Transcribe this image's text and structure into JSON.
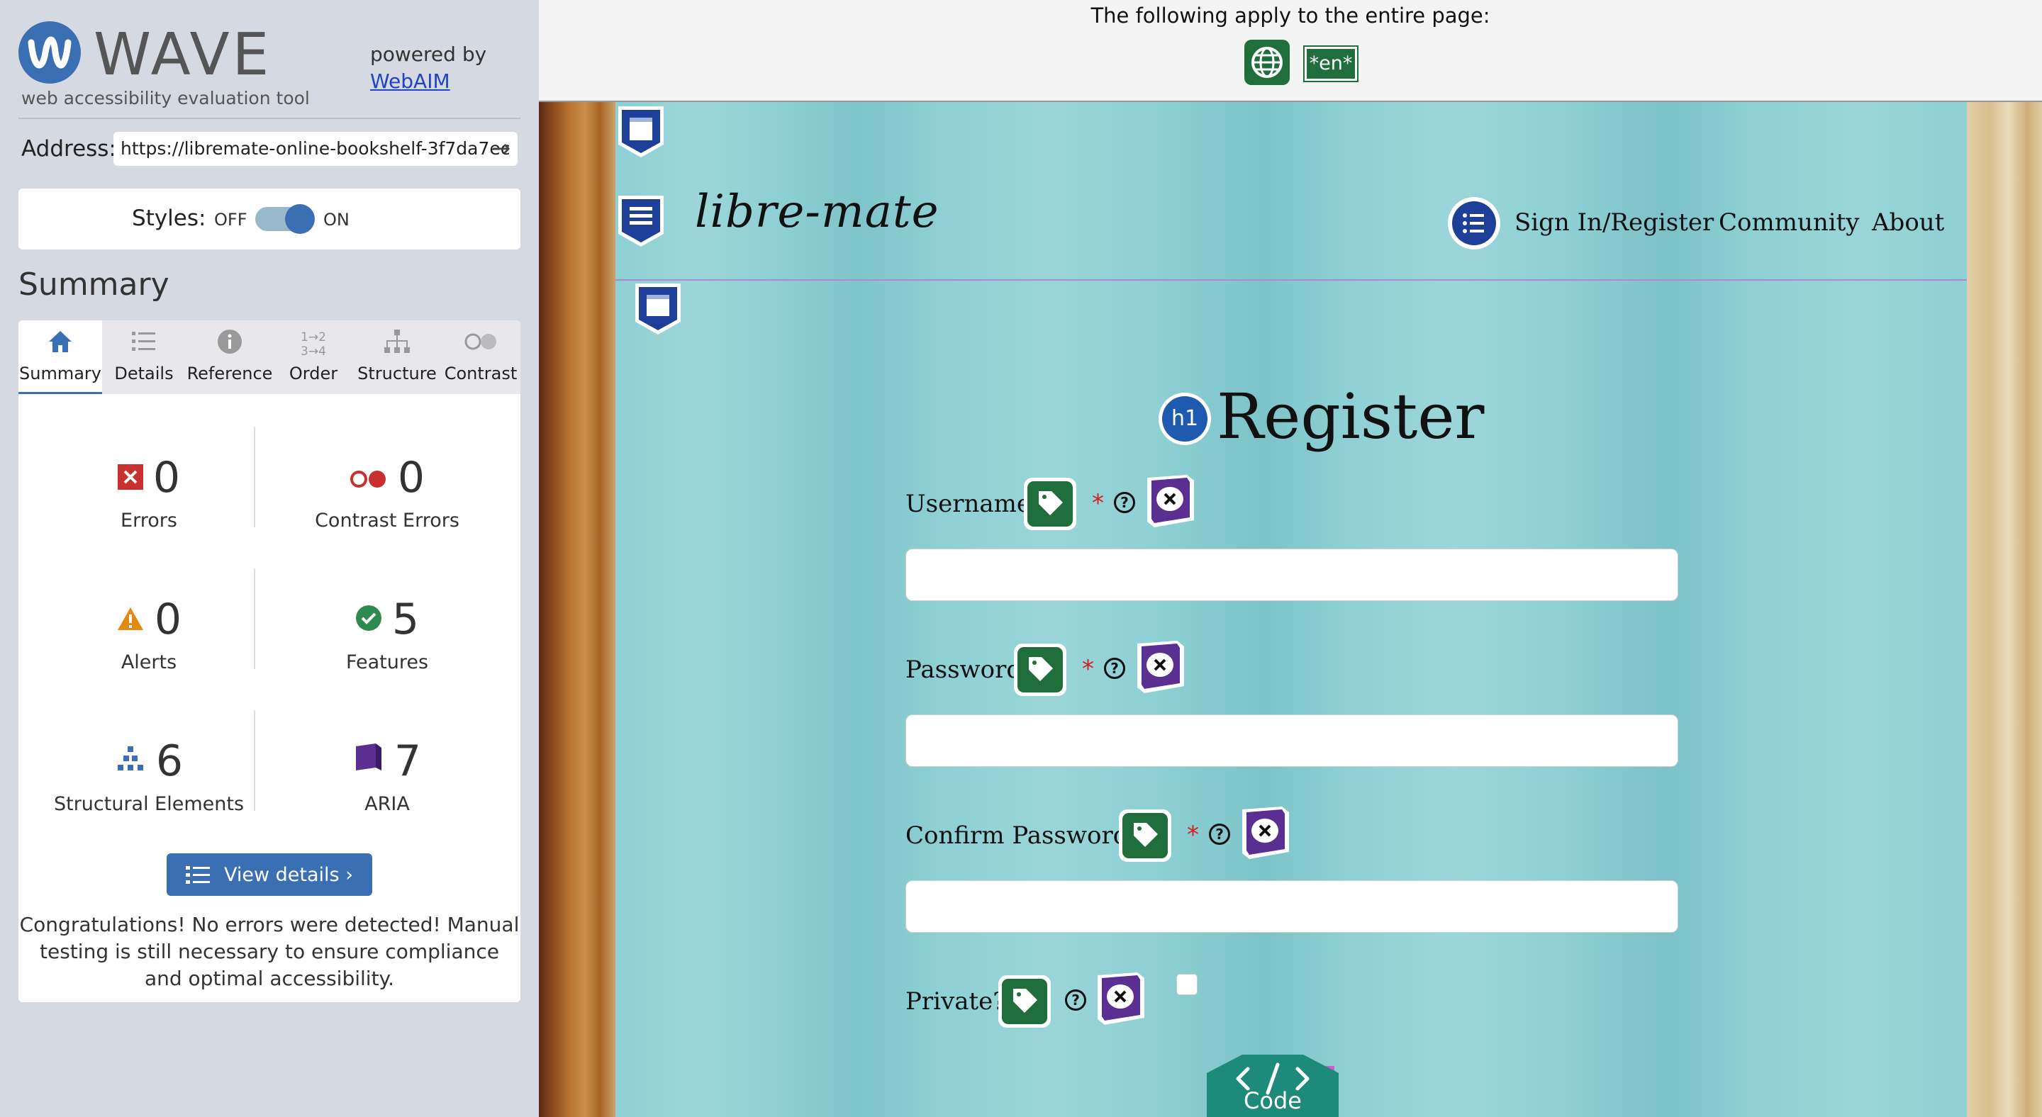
{
  "wave": {
    "logo_text": "WAVE",
    "subtitle": "web accessibility evaluation tool",
    "powered_by": "powered by",
    "webaim_link": "WebAIM",
    "address_label": "Address:",
    "address_value": "https://libremate-online-bookshelf-3f7da7ec",
    "styles_label": "Styles:",
    "styles_off": "OFF",
    "styles_on": "ON",
    "summary_heading": "Summary",
    "tabs": [
      {
        "label": "Summary",
        "icon": "home-icon"
      },
      {
        "label": "Details",
        "icon": "list-icon"
      },
      {
        "label": "Reference",
        "icon": "info-icon"
      },
      {
        "label": "Order",
        "icon": "order-icon"
      },
      {
        "label": "Structure",
        "icon": "structure-icon"
      },
      {
        "label": "Contrast",
        "icon": "contrast-icon"
      }
    ],
    "stats": {
      "errors": {
        "count": "0",
        "label": "Errors"
      },
      "contrast_errors": {
        "count": "0",
        "label": "Contrast Errors"
      },
      "alerts": {
        "count": "0",
        "label": "Alerts"
      },
      "features": {
        "count": "5",
        "label": "Features"
      },
      "structural": {
        "count": "6",
        "label": "Structural Elements"
      },
      "aria": {
        "count": "7",
        "label": "ARIA"
      }
    },
    "view_details": "View details ›",
    "congrats": "Congratulations! No errors were detected! Manual testing is still necessary to ensure compliance and optimal accessibility."
  },
  "page_banner": {
    "text": "The following apply to the entire page:",
    "lang_badge": "*en*"
  },
  "site": {
    "brand": "libre-mate",
    "nav": [
      "Sign  In/Register",
      "Community",
      "About"
    ],
    "heading_badge": "h1",
    "heading": "Register",
    "fields": [
      {
        "label": "Username",
        "required": "*"
      },
      {
        "label": "Password",
        "required": "*"
      },
      {
        "label": "Confirm  Password",
        "required": "*"
      }
    ],
    "private_label": "Private?",
    "code_label": "Code"
  },
  "colors": {
    "wave_blue": "#3a6fb3",
    "feature_green": "#1f6e3c",
    "aria_purple": "#5b2f91",
    "structure_navy": "#1e3f97",
    "error_red": "#c8312f",
    "alert_orange": "#e28a12"
  }
}
